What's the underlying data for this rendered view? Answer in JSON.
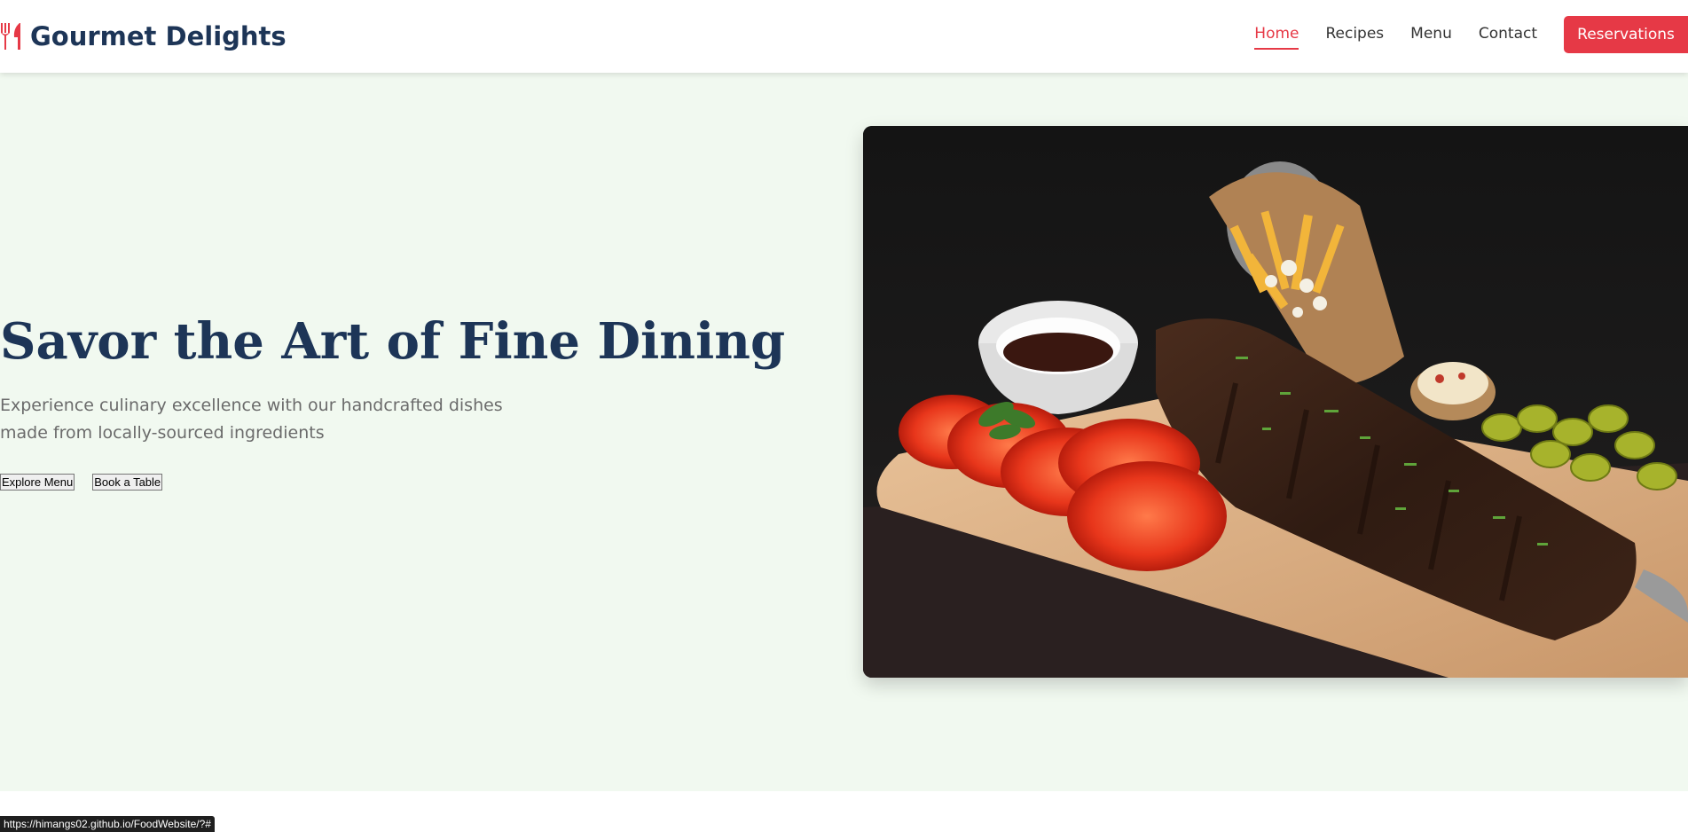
{
  "brand": {
    "name": "Gourmet Delights",
    "icon": "utensils-icon",
    "color": "#1d3557",
    "accent": "#e63946"
  },
  "nav": {
    "items": [
      {
        "label": "Home",
        "active": true
      },
      {
        "label": "Recipes",
        "active": false
      },
      {
        "label": "Menu",
        "active": false
      },
      {
        "label": "Contact",
        "active": false
      }
    ],
    "cta_label": "Reservations"
  },
  "hero": {
    "title": "Savor the Art of Fine Dining",
    "subtitle": "Experience culinary excellence with our handcrafted dishes made from locally-sourced ingredients",
    "buttons": {
      "explore_label": "Explore Menu",
      "book_label": "Book a Table"
    },
    "background": "#f1f9f0",
    "image": "bbq-ribs-platter"
  },
  "status_bar": {
    "url": "https://himangs02.github.io/FoodWebsite/?#"
  }
}
